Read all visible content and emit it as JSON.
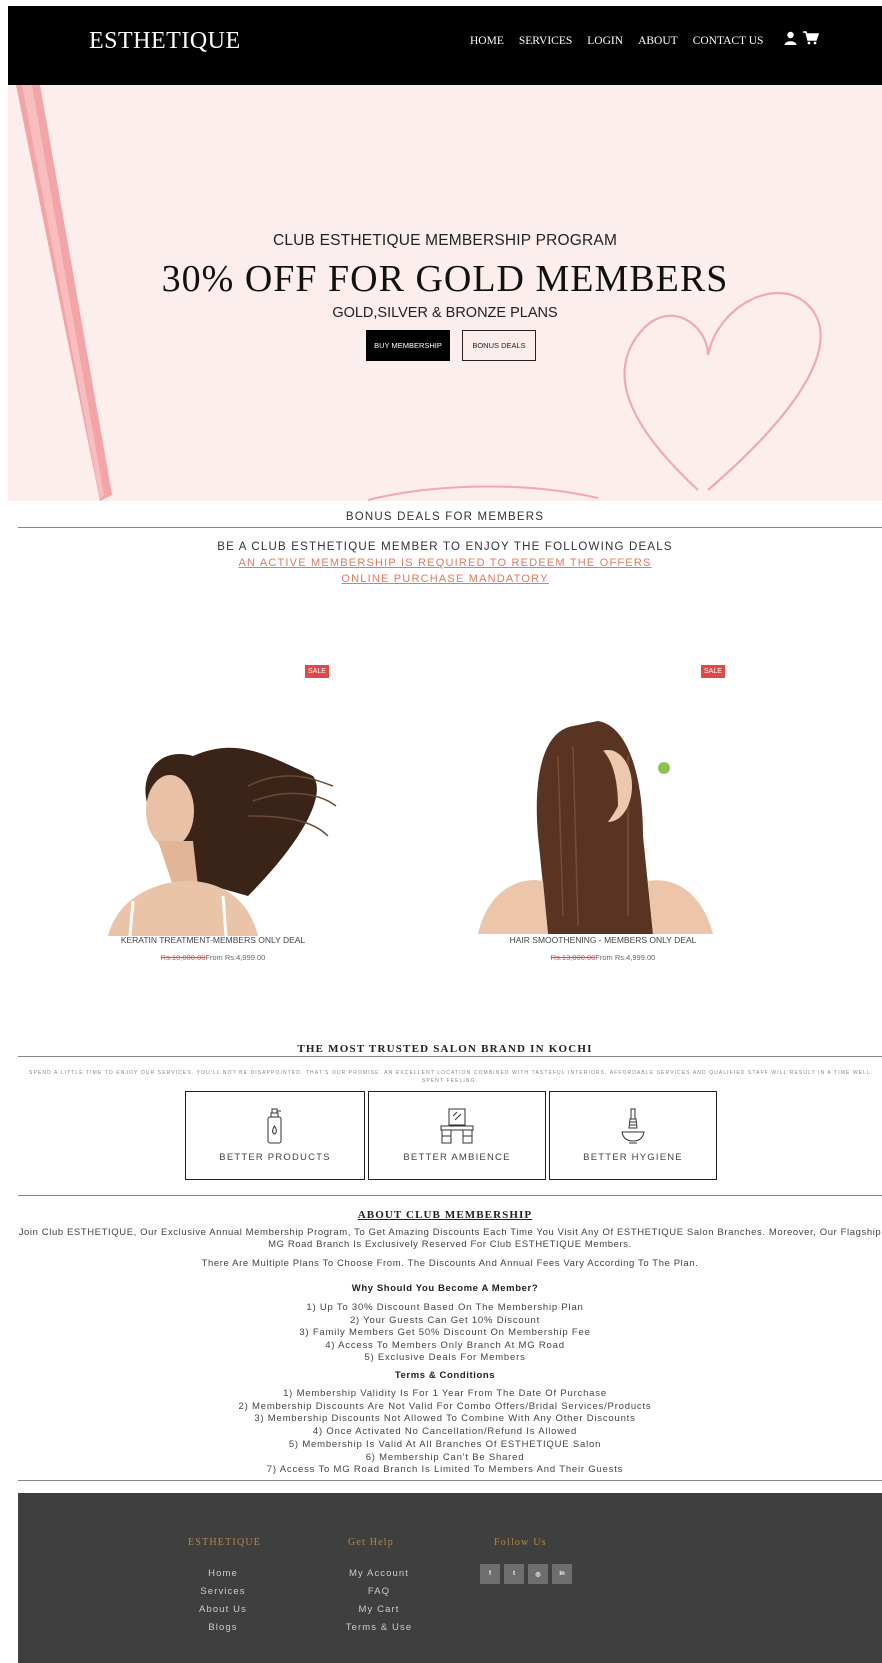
{
  "header": {
    "logo": "ESTHETIQUE",
    "nav": [
      "HOME",
      "SERVICES",
      "LOGIN",
      "ABOUT",
      "CONTACT US"
    ],
    "icons": [
      "user-icon",
      "cart-icon"
    ]
  },
  "hero": {
    "subtitle": "CLUB ESTHETIQUE MEMBERSHIP PROGRAM",
    "title": "30% OFF FOR GOLD MEMBERS",
    "plans": "GOLD,SILVER & BRONZE PLANS",
    "buy_button": "BUY MEMBERSHIP",
    "deals_button": "BONUS DEALS"
  },
  "bonus": {
    "title": "BONUS DEALS FOR MEMBERS",
    "line1": "BE A CLUB ESTHETIQUE MEMBER TO ENJOY THE FOLLOWING DEALS",
    "line2": "AN ACTIVE MEMBERSHIP IS REQUIRED TO REDEEM THE OFFERS",
    "line3": "ONLINE PURCHASE MANDATORY"
  },
  "products": [
    {
      "badge": "SALE",
      "name": "KERATIN TREATMENT-MEMBERS ONLY DEAL",
      "old_price": "Rs.10,000.00",
      "price": "From Rs.4,999.00"
    },
    {
      "badge": "SALE",
      "name": "HAIR SMOOTHENING - MEMBERS ONLY DEAL",
      "old_price": "Rs.13,000.00",
      "price": "From Rs.4,999.00"
    }
  ],
  "trusted": {
    "title": "THE MOST TRUSTED SALON BRAND IN KOCHI",
    "desc": "SPEND A LITTLE TIME TO ENJOY OUR SERVICES. YOU'LL NOT BE DISAPPOINTED. THAT'S OUR PROMISE. AN EXCELLENT LOCATION COMBINED WITH TASTEFUL INTERIORS, AFFORDABLE SERVICES AND QUALIFIED STAFF WILL RESULT IN A TIME WELL SPENT FEELING.",
    "features": [
      "BETTER PRODUCTS",
      "BETTER AMBIENCE",
      "BETTER HYGIENE"
    ]
  },
  "about": {
    "title": "ABOUT CLUB MEMBERSHIP",
    "para1": "Join Club ESTHETIQUE, Our Exclusive Annual Membership Program, To Get Amazing Discounts Each Time You Visit Any Of ESTHETIQUE Salon Branches. Moreover, Our Flagship MG Road Branch Is Exclusively Reserved For Club ESTHETIQUE Members.",
    "para2": "There Are Multiple Plans To Choose From. The Discounts And Annual Fees Vary According To The Plan.",
    "why_title": "Why Should You Become A Member?",
    "why": [
      "1) Up To 30% Discount Based On The Membership Plan",
      "2) Your Guests Can Get 10% Discount",
      "3) Family Members Get 50% Discount On Membership Fee",
      "4) Access To Members Only Branch At MG Road",
      "5) Exclusive Deals For Members"
    ],
    "terms_title": "Terms & Conditions",
    "terms": [
      "1) Membership Validity Is For 1 Year From The Date Of Purchase",
      "2) Membership Discounts Are Not Valid For Combo Offers/Bridal Services/Products",
      "3) Membership Discounts Not Allowed To Combine With Any Other Discounts",
      "4) Once Activated No Cancellation/Refund Is Allowed",
      "5) Membership Is Valid At All Branches Of ESTHETIQUE Salon",
      "6) Membership Can't Be Shared",
      "7) Access To MG Road Branch Is Limited To Members And Their Guests"
    ]
  },
  "footer": {
    "col1_title": "ESTHETIQUE",
    "col1_links": [
      "Home",
      "Services",
      "About Us",
      "Blogs"
    ],
    "col2_title": "Get Help",
    "col2_links": [
      "My Account",
      "FAQ",
      "My Cart",
      "Terms & Use"
    ],
    "col3_title": "Follow Us",
    "social": [
      "facebook-icon",
      "twitter-icon",
      "instagram-icon",
      "linkedin-icon"
    ]
  }
}
